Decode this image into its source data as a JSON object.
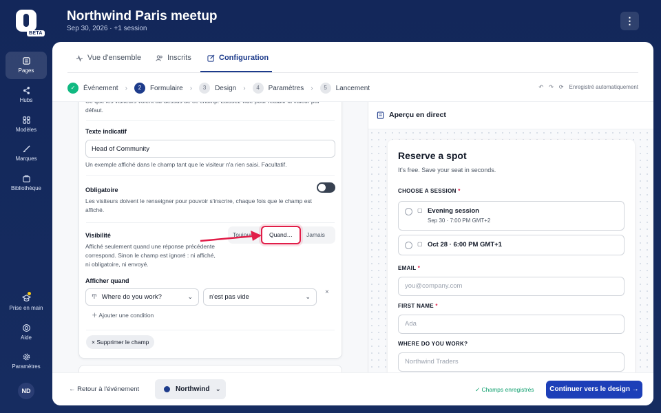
{
  "app": {
    "beta": "BETA"
  },
  "nav": [
    {
      "label": "Pages",
      "icon": "pages-icon"
    },
    {
      "label": "Hubs",
      "icon": "share-icon"
    },
    {
      "label": "Modèles",
      "icon": "grid-icon"
    },
    {
      "label": "Marques",
      "icon": "brush-icon"
    },
    {
      "label": "Bibliothèque",
      "icon": "library-icon"
    }
  ],
  "nav_bottom": [
    {
      "label": "Prise en main",
      "icon": "graduation-icon"
    },
    {
      "label": "Aide",
      "icon": "help-icon"
    },
    {
      "label": "Paramètres",
      "icon": "gear-icon"
    }
  ],
  "user": {
    "initials": "ND"
  },
  "header": {
    "title": "Northwind Paris meetup",
    "subtitle": "Sep 30, 2026 · +1 session",
    "menu": "⋮"
  },
  "tabs": [
    "Vue d'ensemble",
    "Inscrits",
    "Configuration"
  ],
  "steps": [
    {
      "num": "✓",
      "label": "Événement"
    },
    {
      "num": "2",
      "label": "Formulaire"
    },
    {
      "num": "3",
      "label": "Design"
    },
    {
      "num": "4",
      "label": "Paramètres"
    },
    {
      "num": "5",
      "label": "Lancement"
    }
  ],
  "autosave": "Enregistré automatiquement",
  "field": {
    "top_text": "Ce que les visiteurs voient au-dessus de ce champ. Laissez vide pour rétablir la valeur par défaut.",
    "placeholder_label": "Texte indicatif",
    "placeholder_value": "Head of Community",
    "placeholder_help": "Un exemple affiché dans le champ tant que le visiteur n'a rien saisi. Facultatif.",
    "required_label": "Obligatoire",
    "required_help": "Les visiteurs doivent le renseigner pour pouvoir s'inscrire, chaque fois que le champ est affiché.",
    "visibility_label": "Visibilité",
    "visibility_help": "Affiché seulement quand une réponse précédente correspond. Sinon le champ est ignoré : ni affiché, ni obligatoire, ni envoyé.",
    "visibility_options": [
      "Toujours",
      "Quand…",
      "Jamais"
    ],
    "show_when_label": "Afficher quand",
    "condition_field": "Where do you work?",
    "condition_operator": "n'est pas vide",
    "add_condition": "Ajouter une condition",
    "delete_field": "Supprimer le champ"
  },
  "footer": {
    "back": "Retour à l'événement",
    "brand": "Northwind",
    "saved": "Champs enregistrés",
    "cta": "Continuer vers le design"
  },
  "preview": {
    "title": "Aperçu en direct",
    "form_title": "Reserve a spot",
    "form_subtitle": "It's free. Save your seat in seconds.",
    "session_label": "CHOOSE A SESSION",
    "sessions": [
      {
        "name": "Evening session",
        "detail": "Sep 30 · 7:00 PM GMT+2"
      },
      {
        "name": "Oct 28 · 6:00 PM GMT+1",
        "detail": ""
      }
    ],
    "email_label": "EMAIL",
    "email_placeholder": "you@company.com",
    "first_name_label": "FIRST NAME",
    "first_name_placeholder": "Ada",
    "work_label": "WHERE DO YOU WORK?",
    "work_placeholder": "Northwind Traders",
    "required_mark": "*"
  },
  "colors": {
    "navy": "#15295a",
    "primary": "#1d3fb8",
    "highlight": "#e11d48",
    "success": "#10b981"
  }
}
